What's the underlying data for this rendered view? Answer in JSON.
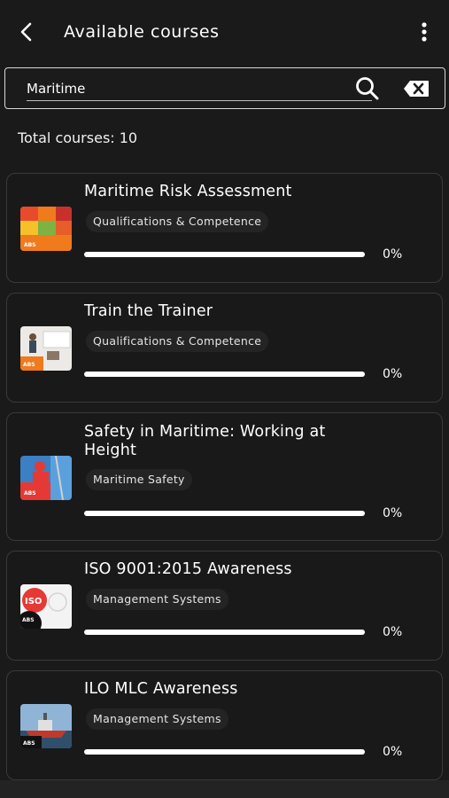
{
  "header": {
    "title": "Available courses",
    "back_icon": "chevron-left-icon",
    "menu_icon": "more-vertical-icon"
  },
  "search": {
    "value": "Maritime",
    "placeholder": "",
    "search_icon": "search-icon",
    "clear_icon": "backspace-icon"
  },
  "summary": {
    "total_label": "Total courses: 10"
  },
  "courses": [
    {
      "title": "Maritime Risk Assessment",
      "category": "Qualifications & Competence",
      "progress_label": "0%",
      "progress": 0,
      "thumb_icon": "risk-matrix-thumbnail"
    },
    {
      "title": "Train the Trainer",
      "category": "Qualifications & Competence",
      "progress_label": "0%",
      "progress": 0,
      "thumb_icon": "classroom-thumbnail"
    },
    {
      "title": "Safety in Maritime: Working at Height",
      "category": "Maritime Safety",
      "progress_label": "0%",
      "progress": 0,
      "thumb_icon": "worker-at-height-thumbnail"
    },
    {
      "title": "ISO 9001:2015 Awareness",
      "category": "Management Systems",
      "progress_label": "0%",
      "progress": 0,
      "thumb_icon": "iso-logo-thumbnail"
    },
    {
      "title": "ILO MLC Awareness",
      "category": "Management Systems",
      "progress_label": "0%",
      "progress": 0,
      "thumb_icon": "ship-thumbnail"
    }
  ],
  "colors": {
    "background": "#1a1a1b",
    "card_border": "#3a3a3c",
    "text": "#ffffff",
    "brand_orange": "#f07a1c",
    "brand_red": "#e53935"
  }
}
